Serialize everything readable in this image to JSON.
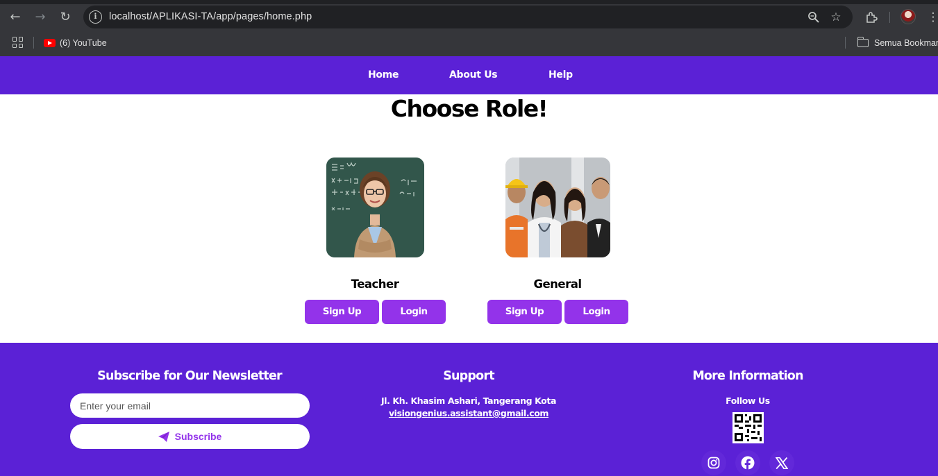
{
  "browser": {
    "url": "localhost/APLIKASI-TA/app/pages/home.php",
    "bookmarks": [
      {
        "label": "(6) YouTube",
        "icon": "youtube-icon"
      }
    ],
    "bookmarks_folder": "Semua Bookmark"
  },
  "nav": {
    "items": [
      {
        "label": "Home"
      },
      {
        "label": "About Us"
      },
      {
        "label": "Help"
      }
    ]
  },
  "main": {
    "title": "Choose Role!",
    "roles": [
      {
        "name": "Teacher",
        "signup_label": "Sign Up",
        "login_label": "Login"
      },
      {
        "name": "General",
        "signup_label": "Sign Up",
        "login_label": "Login"
      }
    ]
  },
  "footer": {
    "newsletter": {
      "title": "Subscribe for Our Newsletter",
      "email_placeholder": "Enter your email",
      "subscribe_label": "Subscribe"
    },
    "support": {
      "title": "Support",
      "address": "Jl. Kh. Khasim Ashari, Tangerang Kota",
      "email": "visiongenius.assistant@gmail.com"
    },
    "more_info": {
      "title": "More Information",
      "follow_label": "Follow Us",
      "socials": [
        "instagram-icon",
        "facebook-icon",
        "x-icon"
      ]
    }
  },
  "colors": {
    "brand_purple": "#5b21d6",
    "button_purple": "#9333ea"
  }
}
